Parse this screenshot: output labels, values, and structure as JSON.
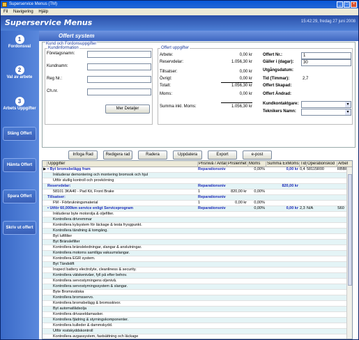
{
  "window": {
    "title": "Superservice Menus (TM)"
  },
  "menu": {
    "items": [
      "Fil",
      "Navigering",
      "Hjälp"
    ]
  },
  "header": {
    "logo": "Superservice Menus",
    "datetime": "15:42:29, fredag 27 juni 2008"
  },
  "sidebar": {
    "items": [
      {
        "num": "1",
        "label": "Fordonsval"
      },
      {
        "num": "2",
        "label": "Val av arbete"
      },
      {
        "num": "3",
        "label": "Arbets Uppgifter"
      },
      {
        "label": "Stäng Offert"
      },
      {
        "label": "Hämta Offert"
      },
      {
        "label": "Spara Offert"
      },
      {
        "label": "Skriv ut offert"
      }
    ]
  },
  "tab": {
    "title": "Offert system"
  },
  "customer": {
    "section_label": "Kund och Fordonsuppgifter",
    "group_label": "Kundinformation",
    "fields": [
      "Företagsnamn:",
      "Kundnamn:",
      "Reg Nr.:",
      "Ch.nr."
    ],
    "more_button": "Mer Detaljer"
  },
  "offer": {
    "group_label": "Offert uppgifter",
    "rows": [
      {
        "label": "Arbete:",
        "value": "0,00 kr"
      },
      {
        "label": "Reservdelar:",
        "value": "1.056,30 kr"
      },
      {
        "label": "Tillsatser:",
        "value": "0,00 kr"
      },
      {
        "label": "Övrigt:",
        "value": "0,00 kr"
      },
      {
        "label": "Totalt:",
        "value": "1.056,30 kr"
      },
      {
        "label": "Moms:",
        "value": "0,00 kr"
      },
      {
        "label": "Summa inkl. Moms:",
        "value": "1.056,30 kr"
      }
    ],
    "right": {
      "offert_nr_label": "Offert Nr.:",
      "offert_nr": "1",
      "galler_label": "Gäller i (dagar):",
      "galler": "30",
      "utgang_label": "Utgångsdatum:",
      "tid_label": "Tid (Timmar):",
      "tid": "2,7",
      "skapad_label": "Offert Skapad:",
      "andrad_label": "Offert Ändrad:",
      "kontakt_label": "Kundkontaktgare:",
      "tekniker_label": "Teknikers Namn:"
    }
  },
  "toolbar": {
    "buttons": [
      "Infoga Rad",
      "Redigera rad",
      "Radera",
      "Uppdatera",
      "Export",
      "e-post"
    ]
  },
  "grid": {
    "headers": [
      "Uppgifter",
      "Prisnivå / Antal",
      "Prislenhet",
      "Moms",
      "Summa ExMoms",
      "Tid",
      "Operationskod",
      "Arbets"
    ],
    "rows": [
      {
        "t": "hd",
        "c": [
          "• Byt bromsbelägg fram",
          "Reparationsnivå",
          "",
          "0,00%",
          "0,00 kr",
          "0,4",
          "58115R00",
          "RBBF"
        ],
        "ptr": true
      },
      {
        "t": "sub",
        "c": [
          "Inkluderar demontering och montering bromsok och hjul",
          "",
          "",
          "",
          "",
          "",
          "",
          ""
        ]
      },
      {
        "t": "sub",
        "c": [
          "Utför slutlig kontroll och provkörning",
          "",
          "",
          "",
          "",
          "",
          "",
          ""
        ]
      },
      {
        "t": "hd",
        "c": [
          "Reservdelar:",
          "Reparationsnivå",
          "",
          "",
          "820,00 kr",
          "",
          "",
          ""
        ]
      },
      {
        "t": "sub",
        "c": [
          "58101 3KA40 - Pad Kit, Front Brake",
          "1",
          "820,00 kr",
          "0,00%",
          "",
          "",
          "",
          ""
        ]
      },
      {
        "t": "hd",
        "c": [
          "Tillsatser:",
          "Reparationsnivå",
          "",
          "",
          "",
          "",
          "",
          ""
        ]
      },
      {
        "t": "sub",
        "c": [
          "FM - Förbrukningsmaterial",
          "1",
          "0,00 kr",
          "0,00%",
          "",
          "",
          "",
          ""
        ]
      },
      {
        "t": "hd",
        "c": [
          "• Utför 60,000km service enligt Serviceprogram",
          "Reparationsnivå",
          "",
          "0,00%",
          "0,00 kr",
          "2,3",
          "N/A",
          "S60"
        ]
      },
      {
        "t": "sub",
        "c": [
          "Inkluderar byte motorolja & oljefilter.",
          "",
          "",
          "",
          "",
          "",
          "",
          ""
        ]
      },
      {
        "t": "sub",
        "c": [
          "Kontrollera drivremmar",
          "",
          "",
          "",
          "",
          "",
          "",
          ""
        ]
      },
      {
        "t": "sub",
        "c": [
          "Kontrollera kylsystem för läckage & testa frysgpunkt.",
          "",
          "",
          "",
          "",
          "",
          "",
          ""
        ]
      },
      {
        "t": "sub",
        "c": [
          "Kontrollera tändning & tomgång.",
          "",
          "",
          "",
          "",
          "",
          "",
          ""
        ]
      },
      {
        "t": "sub",
        "c": [
          "Byt luftfilter",
          "",
          "",
          "",
          "",
          "",
          "",
          ""
        ]
      },
      {
        "t": "sub",
        "c": [
          "Byt Bränslefilter",
          "",
          "",
          "",
          "",
          "",
          "",
          ""
        ]
      },
      {
        "t": "sub",
        "c": [
          "Kontrollera bränsleledningar, slangar & anslutningar.",
          "",
          "",
          "",
          "",
          "",
          "",
          ""
        ]
      },
      {
        "t": "sub",
        "c": [
          "Kontrollera motorns samtliga vakuumslangar.",
          "",
          "",
          "",
          "",
          "",
          "",
          ""
        ]
      },
      {
        "t": "sub",
        "c": [
          "Kontrollera EGR system.",
          "",
          "",
          "",
          "",
          "",
          "",
          ""
        ]
      },
      {
        "t": "sub",
        "c": [
          "Byt Tändstift",
          "",
          "",
          "",
          "",
          "",
          "",
          ""
        ]
      },
      {
        "t": "sub",
        "c": [
          "Inspect battery electrolyte, cleanliness & security.",
          "",
          "",
          "",
          "",
          "",
          "",
          ""
        ]
      },
      {
        "t": "sub",
        "c": [
          "Kontrollera vätskenivåer, fyll på efter behov.",
          "",
          "",
          "",
          "",
          "",
          "",
          ""
        ]
      },
      {
        "t": "sub",
        "c": [
          "Kontrollera servostyrningens oljenivå.",
          "",
          "",
          "",
          "",
          "",
          "",
          ""
        ]
      },
      {
        "t": "sub",
        "c": [
          "Kontrollera servostyrningssystem & slangar.",
          "",
          "",
          "",
          "",
          "",
          "",
          ""
        ]
      },
      {
        "t": "sub",
        "c": [
          "Byte Bromsvätska",
          "",
          "",
          "",
          "",
          "",
          "",
          ""
        ]
      },
      {
        "t": "sub",
        "c": [
          "Kontrollera bromsservo.",
          "",
          "",
          "",
          "",
          "",
          "",
          ""
        ]
      },
      {
        "t": "sub",
        "c": [
          "Kontrollera bromsbelägg & bromsskivor.",
          "",
          "",
          "",
          "",
          "",
          "",
          ""
        ]
      },
      {
        "t": "sub",
        "c": [
          "Byt automatlådsolja",
          "",
          "",
          "",
          "",
          "",
          "",
          ""
        ]
      },
      {
        "t": "sub",
        "c": [
          "Kontrollera drivaxeldamasker.",
          "",
          "",
          "",
          "",
          "",
          "",
          ""
        ]
      },
      {
        "t": "sub",
        "c": [
          "Kontrollera fjädring & styrningskomponenter.",
          "",
          "",
          "",
          "",
          "",
          "",
          ""
        ]
      },
      {
        "t": "sub",
        "c": [
          "Kontrollera kulleder & dammskydd.",
          "",
          "",
          "",
          "",
          "",
          "",
          ""
        ]
      },
      {
        "t": "sub",
        "c": [
          "Utför rostskyddskontroll",
          "",
          "",
          "",
          "",
          "",
          "",
          ""
        ]
      },
      {
        "t": "sub",
        "c": [
          "Kontrollera avgassystem, fastsättning och läckage",
          "",
          "",
          "",
          "",
          "",
          "",
          ""
        ]
      },
      {
        "t": "sub",
        "c": [
          "Kontrollera bromsledningar & slangar.",
          "",
          "",
          "",
          "",
          "",
          "",
          ""
        ]
      }
    ]
  }
}
